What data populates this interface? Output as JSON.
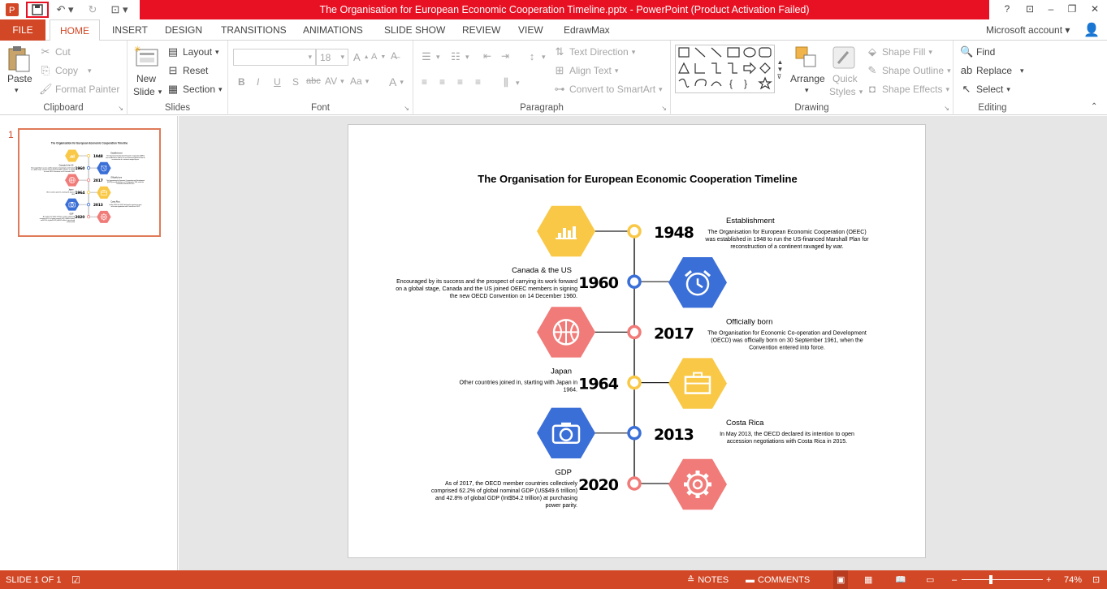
{
  "window": {
    "title": "The Organisation for European Economic Cooperation Timeline.pptx -  PowerPoint (Product Activation Failed)",
    "help": "?",
    "account": "Microsoft account"
  },
  "tabs": [
    "FILE",
    "HOME",
    "INSERT",
    "DESIGN",
    "TRANSITIONS",
    "ANIMATIONS",
    "SLIDE SHOW",
    "REVIEW",
    "VIEW",
    "EdrawMax"
  ],
  "ribbon": {
    "clipboard": {
      "label": "Clipboard",
      "paste": "Paste",
      "cut": "Cut",
      "copy": "Copy",
      "format_painter": "Format Painter"
    },
    "slides": {
      "label": "Slides",
      "new_slide_1": "New",
      "new_slide_2": "Slide",
      "layout": "Layout",
      "reset": "Reset",
      "section": "Section"
    },
    "font": {
      "label": "Font",
      "size": "18",
      "bold": "B",
      "italic": "I",
      "underline": "U",
      "shadow": "S",
      "strike": "abc",
      "spacing": "AV",
      "case": "Aa",
      "grow": "A",
      "shrink": "A",
      "color": "A"
    },
    "paragraph": {
      "label": "Paragraph",
      "text_direction": "Text Direction",
      "align_text": "Align Text",
      "convert_smartart": "Convert to SmartArt"
    },
    "drawing": {
      "label": "Drawing",
      "arrange": "Arrange",
      "quick_styles_1": "Quick",
      "quick_styles_2": "Styles",
      "shape_fill": "Shape Fill",
      "shape_outline": "Shape Outline",
      "shape_effects": "Shape Effects"
    },
    "editing": {
      "label": "Editing",
      "find": "Find",
      "replace": "Replace",
      "select": "Select"
    }
  },
  "thumbnail": {
    "number": "1"
  },
  "slide": {
    "title": "The Organisation for European Economic Cooperation Timeline",
    "events": [
      {
        "year": "1948",
        "heading": "Establishment",
        "body": [
          "The Organisation for European Economic Cooperation (OEEC)",
          "was established in 1948 to run the US-financed Marshall Plan for",
          "reconstruction of a continent ravaged by war."
        ],
        "color": "#f9c846",
        "icon": "bar-chart-icon",
        "side": "right"
      },
      {
        "year": "1960",
        "heading": "Canada & the US",
        "body": [
          "Encouraged by its success and the prospect of carrying its work forward",
          "on a global stage, Canada and the US joined OEEC members in signing",
          "the new OECD Convention on 14 December 1960."
        ],
        "color": "#3b6fd8",
        "icon": "alarm-clock-icon",
        "side": "left"
      },
      {
        "year": "2017",
        "heading": "Officially born",
        "body": [
          "The Organisation for Economic Co-operation and Development",
          "(OECD) was officially born on 30 September 1961, when the",
          "Convention entered into force."
        ],
        "color": "#f07b78",
        "icon": "basketball-icon",
        "side": "right"
      },
      {
        "year": "1964",
        "heading": "Japan",
        "body": [
          "Other countries joined in, starting with Japan in",
          "1964."
        ],
        "color": "#f9c846",
        "icon": "briefcase-icon",
        "side": "left"
      },
      {
        "year": "2013",
        "heading": "Costa Rica",
        "body": [
          "In May 2013, the OECD declared its intention to open",
          "accession negotiations with Costa Rica in 2015."
        ],
        "color": "#3b6fd8",
        "icon": "camera-icon",
        "side": "right"
      },
      {
        "year": "2020",
        "heading": "GDP",
        "body": [
          "As of 2017, the OECD member countries collectively",
          "comprised 62.2% of global nominal GDP (US$49.6 trillion)",
          "and 42.8% of global GDP (Int$54.2 trillion) at purchasing",
          "power parity."
        ],
        "color": "#f07b78",
        "icon": "gear-icon",
        "side": "left"
      }
    ]
  },
  "status": {
    "slide": "SLIDE 1 OF 1",
    "notes": "NOTES",
    "comments": "COMMENTS",
    "zoom": "74%"
  }
}
